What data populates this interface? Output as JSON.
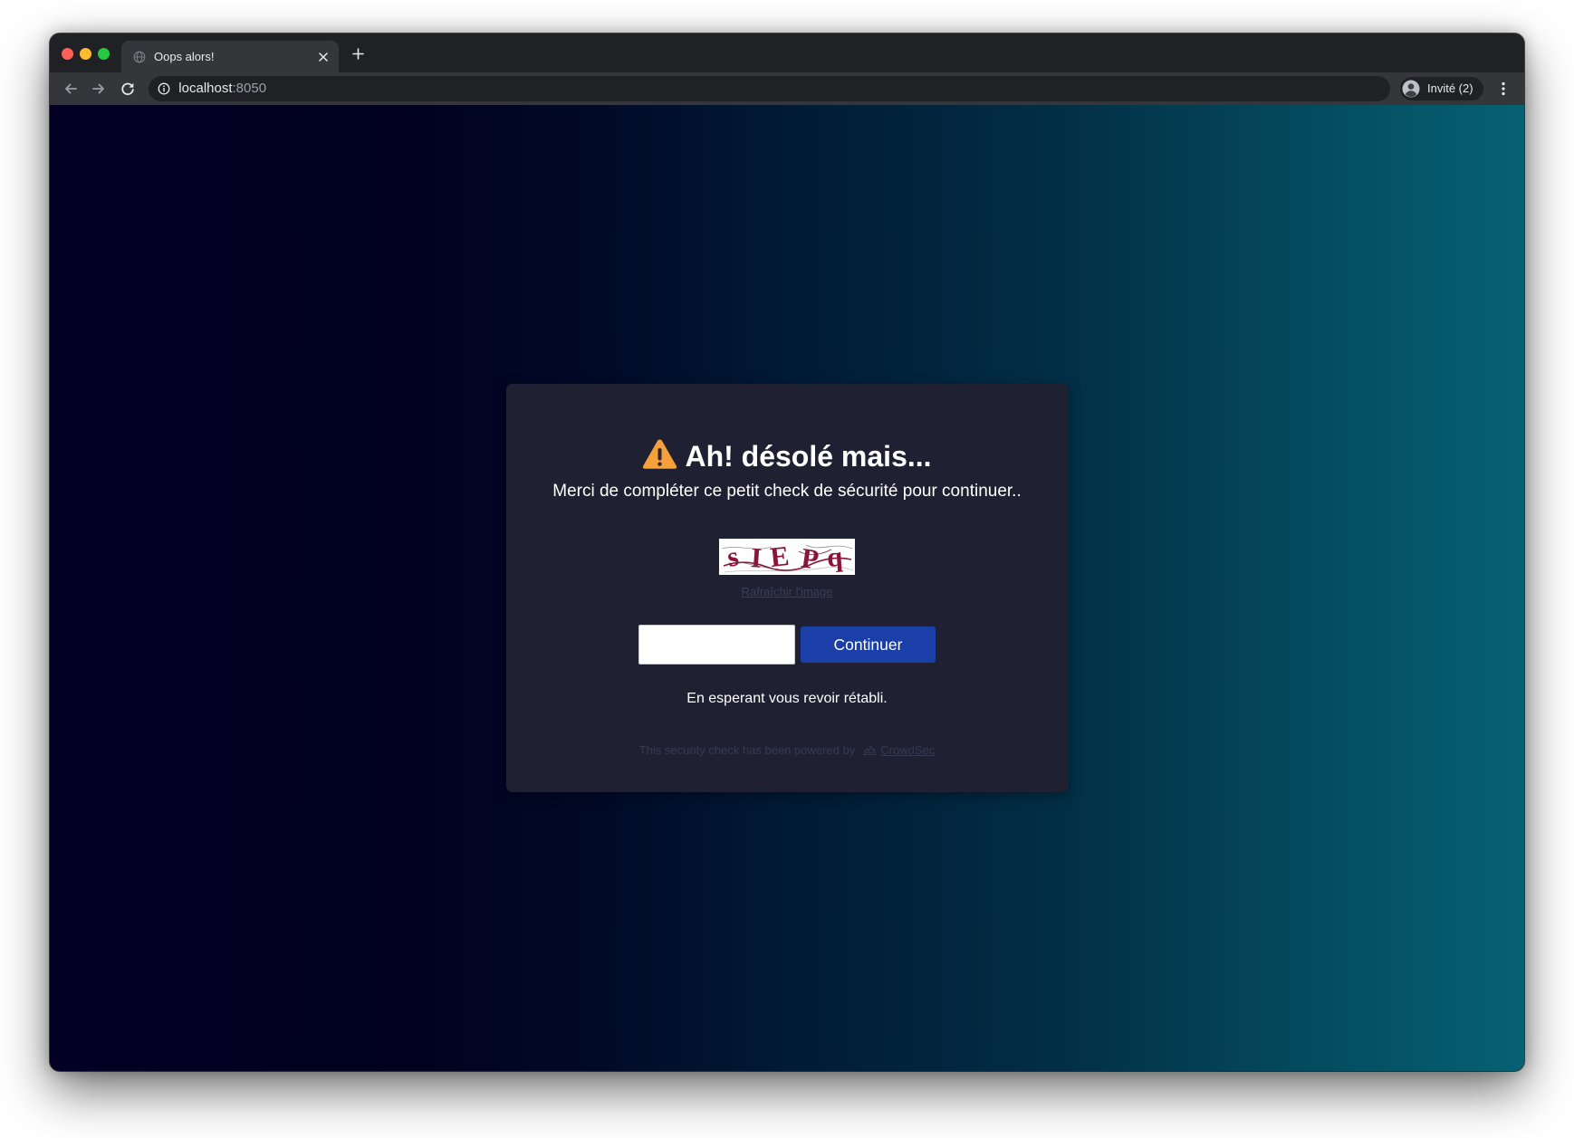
{
  "window": {
    "controls": {
      "close_icon": "close-window-icon",
      "minimize_icon": "minimize-window-icon",
      "zoom_icon": "zoom-window-icon"
    }
  },
  "browser": {
    "tab": {
      "title": "Oops alors!",
      "favicon": "globe-icon",
      "close_icon": "close-icon"
    },
    "new_tab_icon": "plus-icon",
    "nav": {
      "back_icon": "arrow-left-icon",
      "forward_icon": "arrow-right-icon",
      "reload_icon": "reload-icon"
    },
    "address_bar": {
      "security_icon": "info-icon",
      "host": "localhost",
      "port": ":8050"
    },
    "profile": {
      "icon": "avatar-icon",
      "label": "Invité (2)"
    },
    "menu_icon": "kebab-menu-icon"
  },
  "captcha_page": {
    "warning_icon": "warning-icon",
    "title": "Ah! désolé mais...",
    "subtitle": "Merci de compléter ce petit check de sécurité pour continuer..",
    "captcha": {
      "image_text": "sIEPq",
      "refresh_link": "Rafraîchir l'image"
    },
    "submit_label": "Continuer",
    "farewell": "En esperant vous revoir rétabli.",
    "footer": {
      "text": "This security check has been powered by",
      "brand_icon": "crowdsec-logo-icon",
      "brand_link": "CrowdSec"
    }
  },
  "colors": {
    "background_start": "#020024",
    "background_end": "#066173",
    "card_background": "#1f2133",
    "accent": "#1a3fa8",
    "warning": "#f5a03a",
    "captcha_text": "#8a1538",
    "muted_text": "#363a50",
    "browser_frame": "#202124",
    "browser_toolbar": "#35363a",
    "window_close": "#ff5f57",
    "window_minimize": "#febc2e",
    "window_zoom": "#28c840"
  }
}
